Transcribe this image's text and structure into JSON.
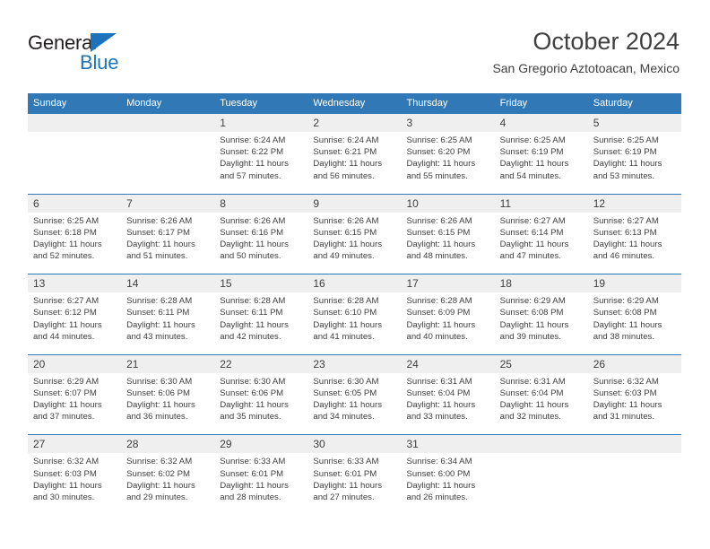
{
  "logo": {
    "word_top": "General",
    "word_bottom": "Blue",
    "triangle_color": "#1b74bb",
    "text_color": "#231f20"
  },
  "header": {
    "title": "October 2024",
    "subtitle": "San Gregorio Aztotoacan, Mexico"
  },
  "theme": {
    "header_blue": "#3179b6",
    "daynum_band": "#efefef",
    "text": "#3f3f3f"
  },
  "calendar": {
    "weekday_headers": [
      "Sunday",
      "Monday",
      "Tuesday",
      "Wednesday",
      "Thursday",
      "Friday",
      "Saturday"
    ],
    "weeks": [
      [
        {
          "day": "",
          "lines": []
        },
        {
          "day": "",
          "lines": []
        },
        {
          "day": "1",
          "lines": [
            "Sunrise: 6:24 AM",
            "Sunset: 6:22 PM",
            "Daylight: 11 hours",
            "and 57 minutes."
          ]
        },
        {
          "day": "2",
          "lines": [
            "Sunrise: 6:24 AM",
            "Sunset: 6:21 PM",
            "Daylight: 11 hours",
            "and 56 minutes."
          ]
        },
        {
          "day": "3",
          "lines": [
            "Sunrise: 6:25 AM",
            "Sunset: 6:20 PM",
            "Daylight: 11 hours",
            "and 55 minutes."
          ]
        },
        {
          "day": "4",
          "lines": [
            "Sunrise: 6:25 AM",
            "Sunset: 6:19 PM",
            "Daylight: 11 hours",
            "and 54 minutes."
          ]
        },
        {
          "day": "5",
          "lines": [
            "Sunrise: 6:25 AM",
            "Sunset: 6:19 PM",
            "Daylight: 11 hours",
            "and 53 minutes."
          ]
        }
      ],
      [
        {
          "day": "6",
          "lines": [
            "Sunrise: 6:25 AM",
            "Sunset: 6:18 PM",
            "Daylight: 11 hours",
            "and 52 minutes."
          ]
        },
        {
          "day": "7",
          "lines": [
            "Sunrise: 6:26 AM",
            "Sunset: 6:17 PM",
            "Daylight: 11 hours",
            "and 51 minutes."
          ]
        },
        {
          "day": "8",
          "lines": [
            "Sunrise: 6:26 AM",
            "Sunset: 6:16 PM",
            "Daylight: 11 hours",
            "and 50 minutes."
          ]
        },
        {
          "day": "9",
          "lines": [
            "Sunrise: 6:26 AM",
            "Sunset: 6:15 PM",
            "Daylight: 11 hours",
            "and 49 minutes."
          ]
        },
        {
          "day": "10",
          "lines": [
            "Sunrise: 6:26 AM",
            "Sunset: 6:15 PM",
            "Daylight: 11 hours",
            "and 48 minutes."
          ]
        },
        {
          "day": "11",
          "lines": [
            "Sunrise: 6:27 AM",
            "Sunset: 6:14 PM",
            "Daylight: 11 hours",
            "and 47 minutes."
          ]
        },
        {
          "day": "12",
          "lines": [
            "Sunrise: 6:27 AM",
            "Sunset: 6:13 PM",
            "Daylight: 11 hours",
            "and 46 minutes."
          ]
        }
      ],
      [
        {
          "day": "13",
          "lines": [
            "Sunrise: 6:27 AM",
            "Sunset: 6:12 PM",
            "Daylight: 11 hours",
            "and 44 minutes."
          ]
        },
        {
          "day": "14",
          "lines": [
            "Sunrise: 6:28 AM",
            "Sunset: 6:11 PM",
            "Daylight: 11 hours",
            "and 43 minutes."
          ]
        },
        {
          "day": "15",
          "lines": [
            "Sunrise: 6:28 AM",
            "Sunset: 6:11 PM",
            "Daylight: 11 hours",
            "and 42 minutes."
          ]
        },
        {
          "day": "16",
          "lines": [
            "Sunrise: 6:28 AM",
            "Sunset: 6:10 PM",
            "Daylight: 11 hours",
            "and 41 minutes."
          ]
        },
        {
          "day": "17",
          "lines": [
            "Sunrise: 6:28 AM",
            "Sunset: 6:09 PM",
            "Daylight: 11 hours",
            "and 40 minutes."
          ]
        },
        {
          "day": "18",
          "lines": [
            "Sunrise: 6:29 AM",
            "Sunset: 6:08 PM",
            "Daylight: 11 hours",
            "and 39 minutes."
          ]
        },
        {
          "day": "19",
          "lines": [
            "Sunrise: 6:29 AM",
            "Sunset: 6:08 PM",
            "Daylight: 11 hours",
            "and 38 minutes."
          ]
        }
      ],
      [
        {
          "day": "20",
          "lines": [
            "Sunrise: 6:29 AM",
            "Sunset: 6:07 PM",
            "Daylight: 11 hours",
            "and 37 minutes."
          ]
        },
        {
          "day": "21",
          "lines": [
            "Sunrise: 6:30 AM",
            "Sunset: 6:06 PM",
            "Daylight: 11 hours",
            "and 36 minutes."
          ]
        },
        {
          "day": "22",
          "lines": [
            "Sunrise: 6:30 AM",
            "Sunset: 6:06 PM",
            "Daylight: 11 hours",
            "and 35 minutes."
          ]
        },
        {
          "day": "23",
          "lines": [
            "Sunrise: 6:30 AM",
            "Sunset: 6:05 PM",
            "Daylight: 11 hours",
            "and 34 minutes."
          ]
        },
        {
          "day": "24",
          "lines": [
            "Sunrise: 6:31 AM",
            "Sunset: 6:04 PM",
            "Daylight: 11 hours",
            "and 33 minutes."
          ]
        },
        {
          "day": "25",
          "lines": [
            "Sunrise: 6:31 AM",
            "Sunset: 6:04 PM",
            "Daylight: 11 hours",
            "and 32 minutes."
          ]
        },
        {
          "day": "26",
          "lines": [
            "Sunrise: 6:32 AM",
            "Sunset: 6:03 PM",
            "Daylight: 11 hours",
            "and 31 minutes."
          ]
        }
      ],
      [
        {
          "day": "27",
          "lines": [
            "Sunrise: 6:32 AM",
            "Sunset: 6:03 PM",
            "Daylight: 11 hours",
            "and 30 minutes."
          ]
        },
        {
          "day": "28",
          "lines": [
            "Sunrise: 6:32 AM",
            "Sunset: 6:02 PM",
            "Daylight: 11 hours",
            "and 29 minutes."
          ]
        },
        {
          "day": "29",
          "lines": [
            "Sunrise: 6:33 AM",
            "Sunset: 6:01 PM",
            "Daylight: 11 hours",
            "and 28 minutes."
          ]
        },
        {
          "day": "30",
          "lines": [
            "Sunrise: 6:33 AM",
            "Sunset: 6:01 PM",
            "Daylight: 11 hours",
            "and 27 minutes."
          ]
        },
        {
          "day": "31",
          "lines": [
            "Sunrise: 6:34 AM",
            "Sunset: 6:00 PM",
            "Daylight: 11 hours",
            "and 26 minutes."
          ]
        },
        {
          "day": "",
          "lines": []
        },
        {
          "day": "",
          "lines": []
        }
      ]
    ]
  }
}
